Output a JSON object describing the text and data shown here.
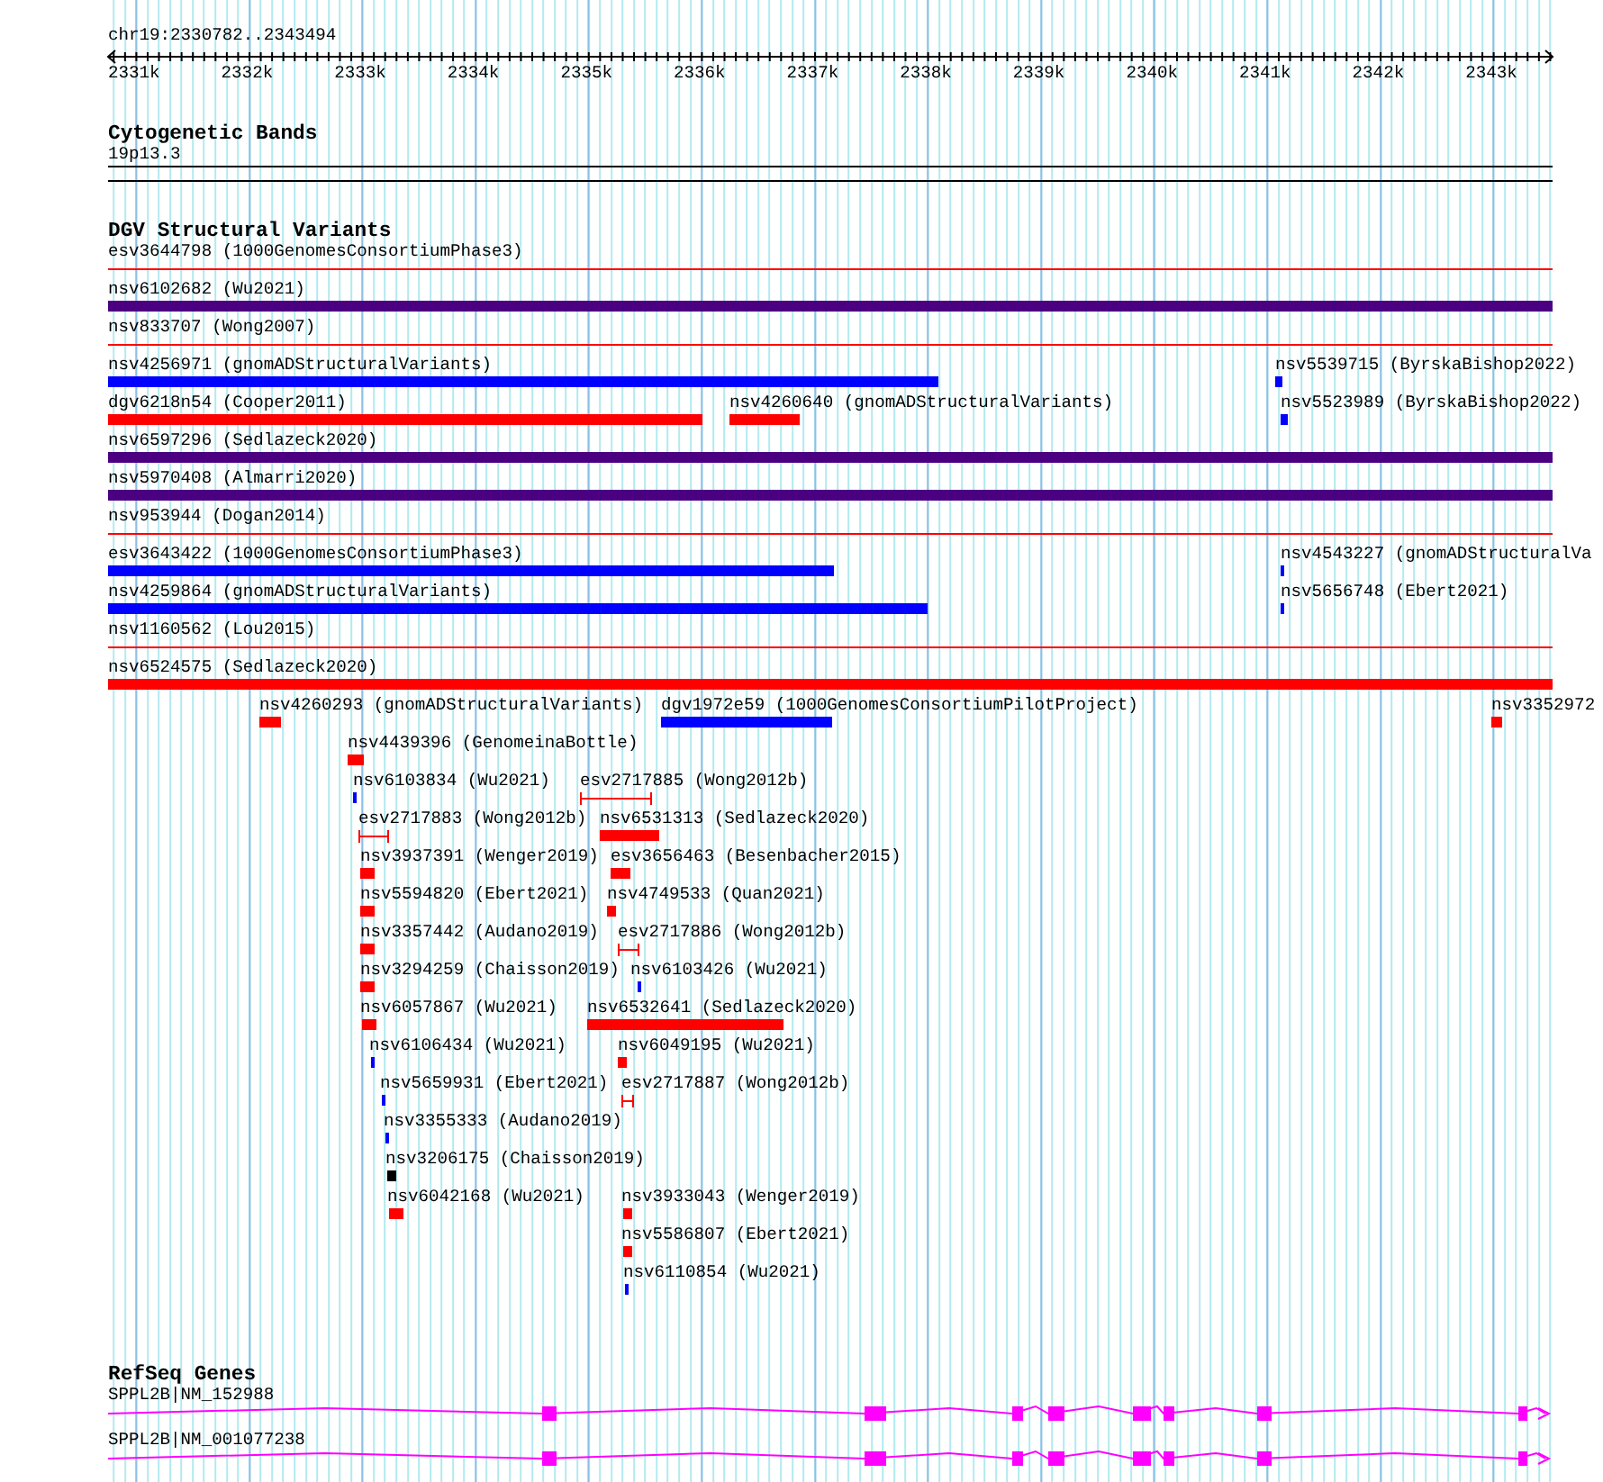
{
  "ruler": {
    "location": "chr19:2330782..2343494",
    "ticks": [
      "2331k",
      "2332k",
      "2333k",
      "2334k",
      "2335k",
      "2336k",
      "2337k",
      "2338k",
      "2339k",
      "2340k",
      "2341k",
      "2342k",
      "2343k"
    ]
  },
  "tracks": [
    {
      "title": "Cytogenetic Bands",
      "kind": "bands",
      "features": [
        {
          "label": "19p13.3"
        }
      ]
    },
    {
      "title": "DGV Structural Variants",
      "kind": "variants",
      "features": [
        {
          "label": "esv3644798 (1000GenomesConsortiumPhase3)",
          "kind": "line",
          "color": "#ff0000"
        },
        {
          "label": "nsv6102682 (Wu2021)",
          "kind": "bar",
          "color": "#4b0082"
        },
        {
          "label": "nsv833707 (Wong2007)",
          "kind": "line",
          "color": "#ff0000"
        },
        {
          "label": "nsv4256971 (gnomADStructuralVariants)",
          "kind": "bar",
          "color": "#0000ff"
        },
        {
          "label": "nsv5539715 (ByrskaBishop2022)",
          "kind": "bar",
          "color": "#0000ff"
        },
        {
          "label": "dgv6218n54 (Cooper2011)",
          "kind": "bar",
          "color": "#ff0000"
        },
        {
          "label": "nsv4260640 (gnomADStructuralVariants)",
          "kind": "bar",
          "color": "#ff0000"
        },
        {
          "label": "nsv5523989 (ByrskaBishop2022)",
          "kind": "bar",
          "color": "#0000ff"
        },
        {
          "label": "nsv6597296 (Sedlazeck2020)",
          "kind": "bar",
          "color": "#4b0082"
        },
        {
          "label": "nsv5970408 (Almarri2020)",
          "kind": "bar",
          "color": "#4b0082"
        },
        {
          "label": "nsv953944 (Dogan2014)",
          "kind": "line",
          "color": "#ff0000"
        },
        {
          "label": "esv3643422 (1000GenomesConsortiumPhase3)",
          "kind": "bar",
          "color": "#0000ff"
        },
        {
          "label": "nsv4543227 (gnomADStructuralVa",
          "kind": "bar",
          "color": "#0000ff"
        },
        {
          "label": "nsv4259864 (gnomADStructuralVariants)",
          "kind": "bar",
          "color": "#0000ff"
        },
        {
          "label": "nsv5656748 (Ebert2021)",
          "kind": "bar",
          "color": "#0000ff"
        },
        {
          "label": "nsv1160562 (Lou2015)",
          "kind": "line",
          "color": "#ff0000"
        },
        {
          "label": "nsv6524575 (Sedlazeck2020)",
          "kind": "bar",
          "color": "#ff0000"
        },
        {
          "label": "nsv4260293 (gnomADStructuralVariants)",
          "kind": "bar",
          "color": "#ff0000"
        },
        {
          "label": "dgv1972e59 (1000GenomesConsortiumPilotProject)",
          "kind": "bar",
          "color": "#0000ff"
        },
        {
          "label": "nsv3352972",
          "kind": "bar",
          "color": "#ff0000"
        },
        {
          "label": "nsv4439396 (GenomeinaBottle)",
          "kind": "bar",
          "color": "#ff0000"
        },
        {
          "label": "nsv6103834 (Wu2021)",
          "kind": "bar",
          "color": "#0000ff"
        },
        {
          "label": "esv2717885 (Wong2012b)",
          "kind": "range",
          "color": "#ff0000"
        },
        {
          "label": "esv2717883 (Wong2012b)",
          "kind": "range",
          "color": "#ff0000"
        },
        {
          "label": "nsv6531313 (Sedlazeck2020)",
          "kind": "bar",
          "color": "#ff0000"
        },
        {
          "label": "nsv3937391 (Wenger2019)",
          "kind": "bar",
          "color": "#ff0000"
        },
        {
          "label": "esv3656463 (Besenbacher2015)",
          "kind": "bar",
          "color": "#ff0000"
        },
        {
          "label": "nsv5594820 (Ebert2021)",
          "kind": "bar",
          "color": "#ff0000"
        },
        {
          "label": "nsv4749533 (Quan2021)",
          "kind": "bar",
          "color": "#ff0000"
        },
        {
          "label": "nsv3357442 (Audano2019)",
          "kind": "bar",
          "color": "#ff0000"
        },
        {
          "label": "esv2717886 (Wong2012b)",
          "kind": "range",
          "color": "#ff0000"
        },
        {
          "label": "nsv3294259 (Chaisson2019)",
          "kind": "bar",
          "color": "#ff0000"
        },
        {
          "label": "nsv6103426 (Wu2021)",
          "kind": "bar",
          "color": "#0000ff"
        },
        {
          "label": "nsv6057867 (Wu2021)",
          "kind": "bar",
          "color": "#ff0000"
        },
        {
          "label": "nsv6532641 (Sedlazeck2020)",
          "kind": "bar",
          "color": "#ff0000"
        },
        {
          "label": "nsv6106434 (Wu2021)",
          "kind": "bar",
          "color": "#0000ff"
        },
        {
          "label": "nsv6049195 (Wu2021)",
          "kind": "bar",
          "color": "#ff0000"
        },
        {
          "label": "nsv5659931 (Ebert2021)",
          "kind": "bar",
          "color": "#0000ff"
        },
        {
          "label": "esv2717887 (Wong2012b)",
          "kind": "range",
          "color": "#ff0000"
        },
        {
          "label": "nsv3355333 (Audano2019)",
          "kind": "bar",
          "color": "#0000ff"
        },
        {
          "label": "nsv3206175 (Chaisson2019)",
          "kind": "bar",
          "color": "#000000"
        },
        {
          "label": "nsv6042168 (Wu2021)",
          "kind": "bar",
          "color": "#ff0000"
        },
        {
          "label": "nsv3933043 (Wenger2019)",
          "kind": "bar",
          "color": "#ff0000"
        },
        {
          "label": "nsv5586807 (Ebert2021)",
          "kind": "bar",
          "color": "#ff0000"
        },
        {
          "label": "nsv6110854 (Wu2021)",
          "kind": "bar",
          "color": "#0000ff"
        }
      ]
    },
    {
      "title": "RefSeq Genes",
      "kind": "genes",
      "features": [
        {
          "label": "SPPL2B|NM_152988"
        },
        {
          "label": "SPPL2B|NM_001077238"
        }
      ]
    }
  ]
}
